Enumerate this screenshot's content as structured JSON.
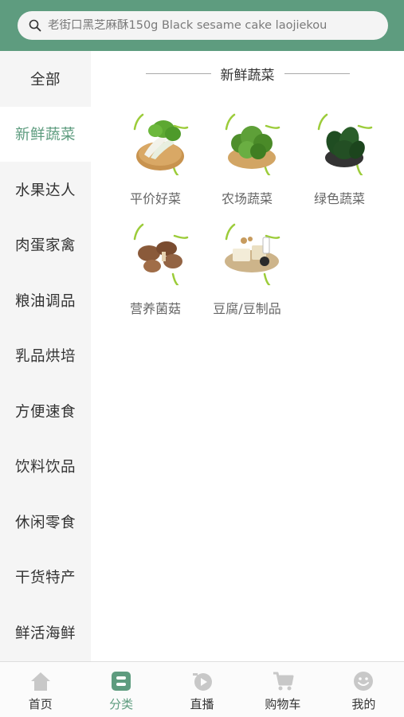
{
  "search": {
    "placeholder": "老街口黑芝麻酥150g Black sesame cake laojiekou"
  },
  "sidebar": {
    "items": [
      {
        "label": "全部"
      },
      {
        "label": "新鲜蔬菜",
        "active": true
      },
      {
        "label": "水果达人"
      },
      {
        "label": "肉蛋家禽"
      },
      {
        "label": "粮油调品"
      },
      {
        "label": "乳品烘培"
      },
      {
        "label": "方便速食"
      },
      {
        "label": "饮料饮品"
      },
      {
        "label": "休闲零食"
      },
      {
        "label": "干货特产"
      },
      {
        "label": "鲜活海鲜"
      }
    ]
  },
  "main": {
    "section_title": "新鲜蔬菜",
    "categories": [
      {
        "label": "平价好菜",
        "icon": "bok-choy-image"
      },
      {
        "label": "农场蔬菜",
        "icon": "greens-basket-image"
      },
      {
        "label": "绿色蔬菜",
        "icon": "spinach-image"
      },
      {
        "label": "营养菌菇",
        "icon": "mushrooms-image"
      },
      {
        "label": "豆腐/豆制品",
        "icon": "tofu-image"
      }
    ]
  },
  "tabbar": {
    "tabs": [
      {
        "label": "首页",
        "icon": "home-icon"
      },
      {
        "label": "分类",
        "icon": "category-icon",
        "active": true
      },
      {
        "label": "直播",
        "icon": "live-icon"
      },
      {
        "label": "购物车",
        "icon": "cart-icon"
      },
      {
        "label": "我的",
        "icon": "profile-icon"
      }
    ]
  },
  "colors": {
    "accent": "#5e9c7f",
    "sidebar_bg": "#f5f5f5",
    "inactive_icon": "#c8c8c8"
  }
}
